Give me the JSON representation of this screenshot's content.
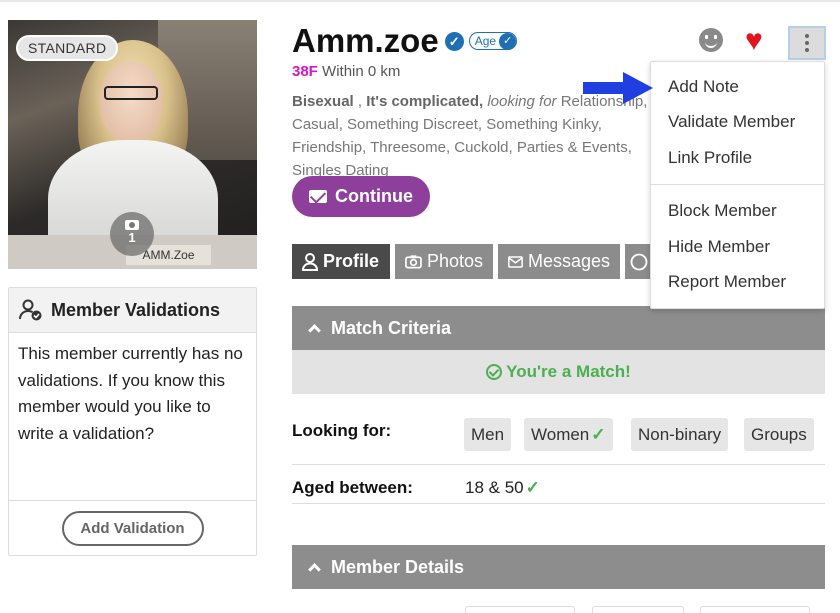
{
  "profile": {
    "username": "Amm.zoe",
    "age_badge": "Age",
    "age_gender": "38F",
    "distance": "Within 0 km",
    "tier_badge": "STANDARD",
    "photo_count": "1",
    "nameplate": "AMM.Zoe",
    "orientation": "Bisexual",
    "status": "It's complicated,",
    "looking_for_prefix": "looking for",
    "looking_for_text": "Relationship, Casual, Something Discreet, Something Kinky, Friendship, Threesome, Cuckold, Parties & Events, Singles Dating"
  },
  "actions": {
    "continue_label": "Continue"
  },
  "tabs": [
    {
      "label": "Profile"
    },
    {
      "label": "Photos"
    },
    {
      "label": "Messages"
    }
  ],
  "validations": {
    "title": "Member Validations",
    "body": "This member currently has no validations. If you know this member would you like to write a validation?",
    "button": "Add Validation"
  },
  "menu": {
    "items": [
      {
        "label": "Add Note"
      },
      {
        "label": "Validate Member"
      },
      {
        "label": "Link Profile"
      },
      {
        "label": "Block Member"
      },
      {
        "label": "Hide Member"
      },
      {
        "label": "Report Member"
      }
    ]
  },
  "match_criteria": {
    "title": "Match Criteria",
    "match_text": "You're a Match!",
    "looking_for_label": "Looking for:",
    "looking_for_options": [
      {
        "label": "Men",
        "matched": false
      },
      {
        "label": "Women",
        "matched": true
      },
      {
        "label": "Non-binary",
        "matched": false
      },
      {
        "label": "Groups",
        "matched": false
      }
    ],
    "aged_label": "Aged between:",
    "aged_value": "18 & 50"
  },
  "member_details": {
    "title": "Member Details"
  },
  "colors": {
    "accent_purple": "#8e3e9b",
    "age_magenta": "#d316c4",
    "match_green": "#4caf50",
    "heart_red": "#e0161c",
    "arrow_blue": "#1f3fe0"
  },
  "icons": [
    "camera-icon",
    "user-check-icon",
    "verified-icon",
    "smiley-icon",
    "heart-icon",
    "kebab-menu-icon",
    "mail-check-icon",
    "user-icon",
    "chevron-up-icon",
    "check-circle-icon",
    "checkmark-icon",
    "arrow-pointer-icon"
  ]
}
